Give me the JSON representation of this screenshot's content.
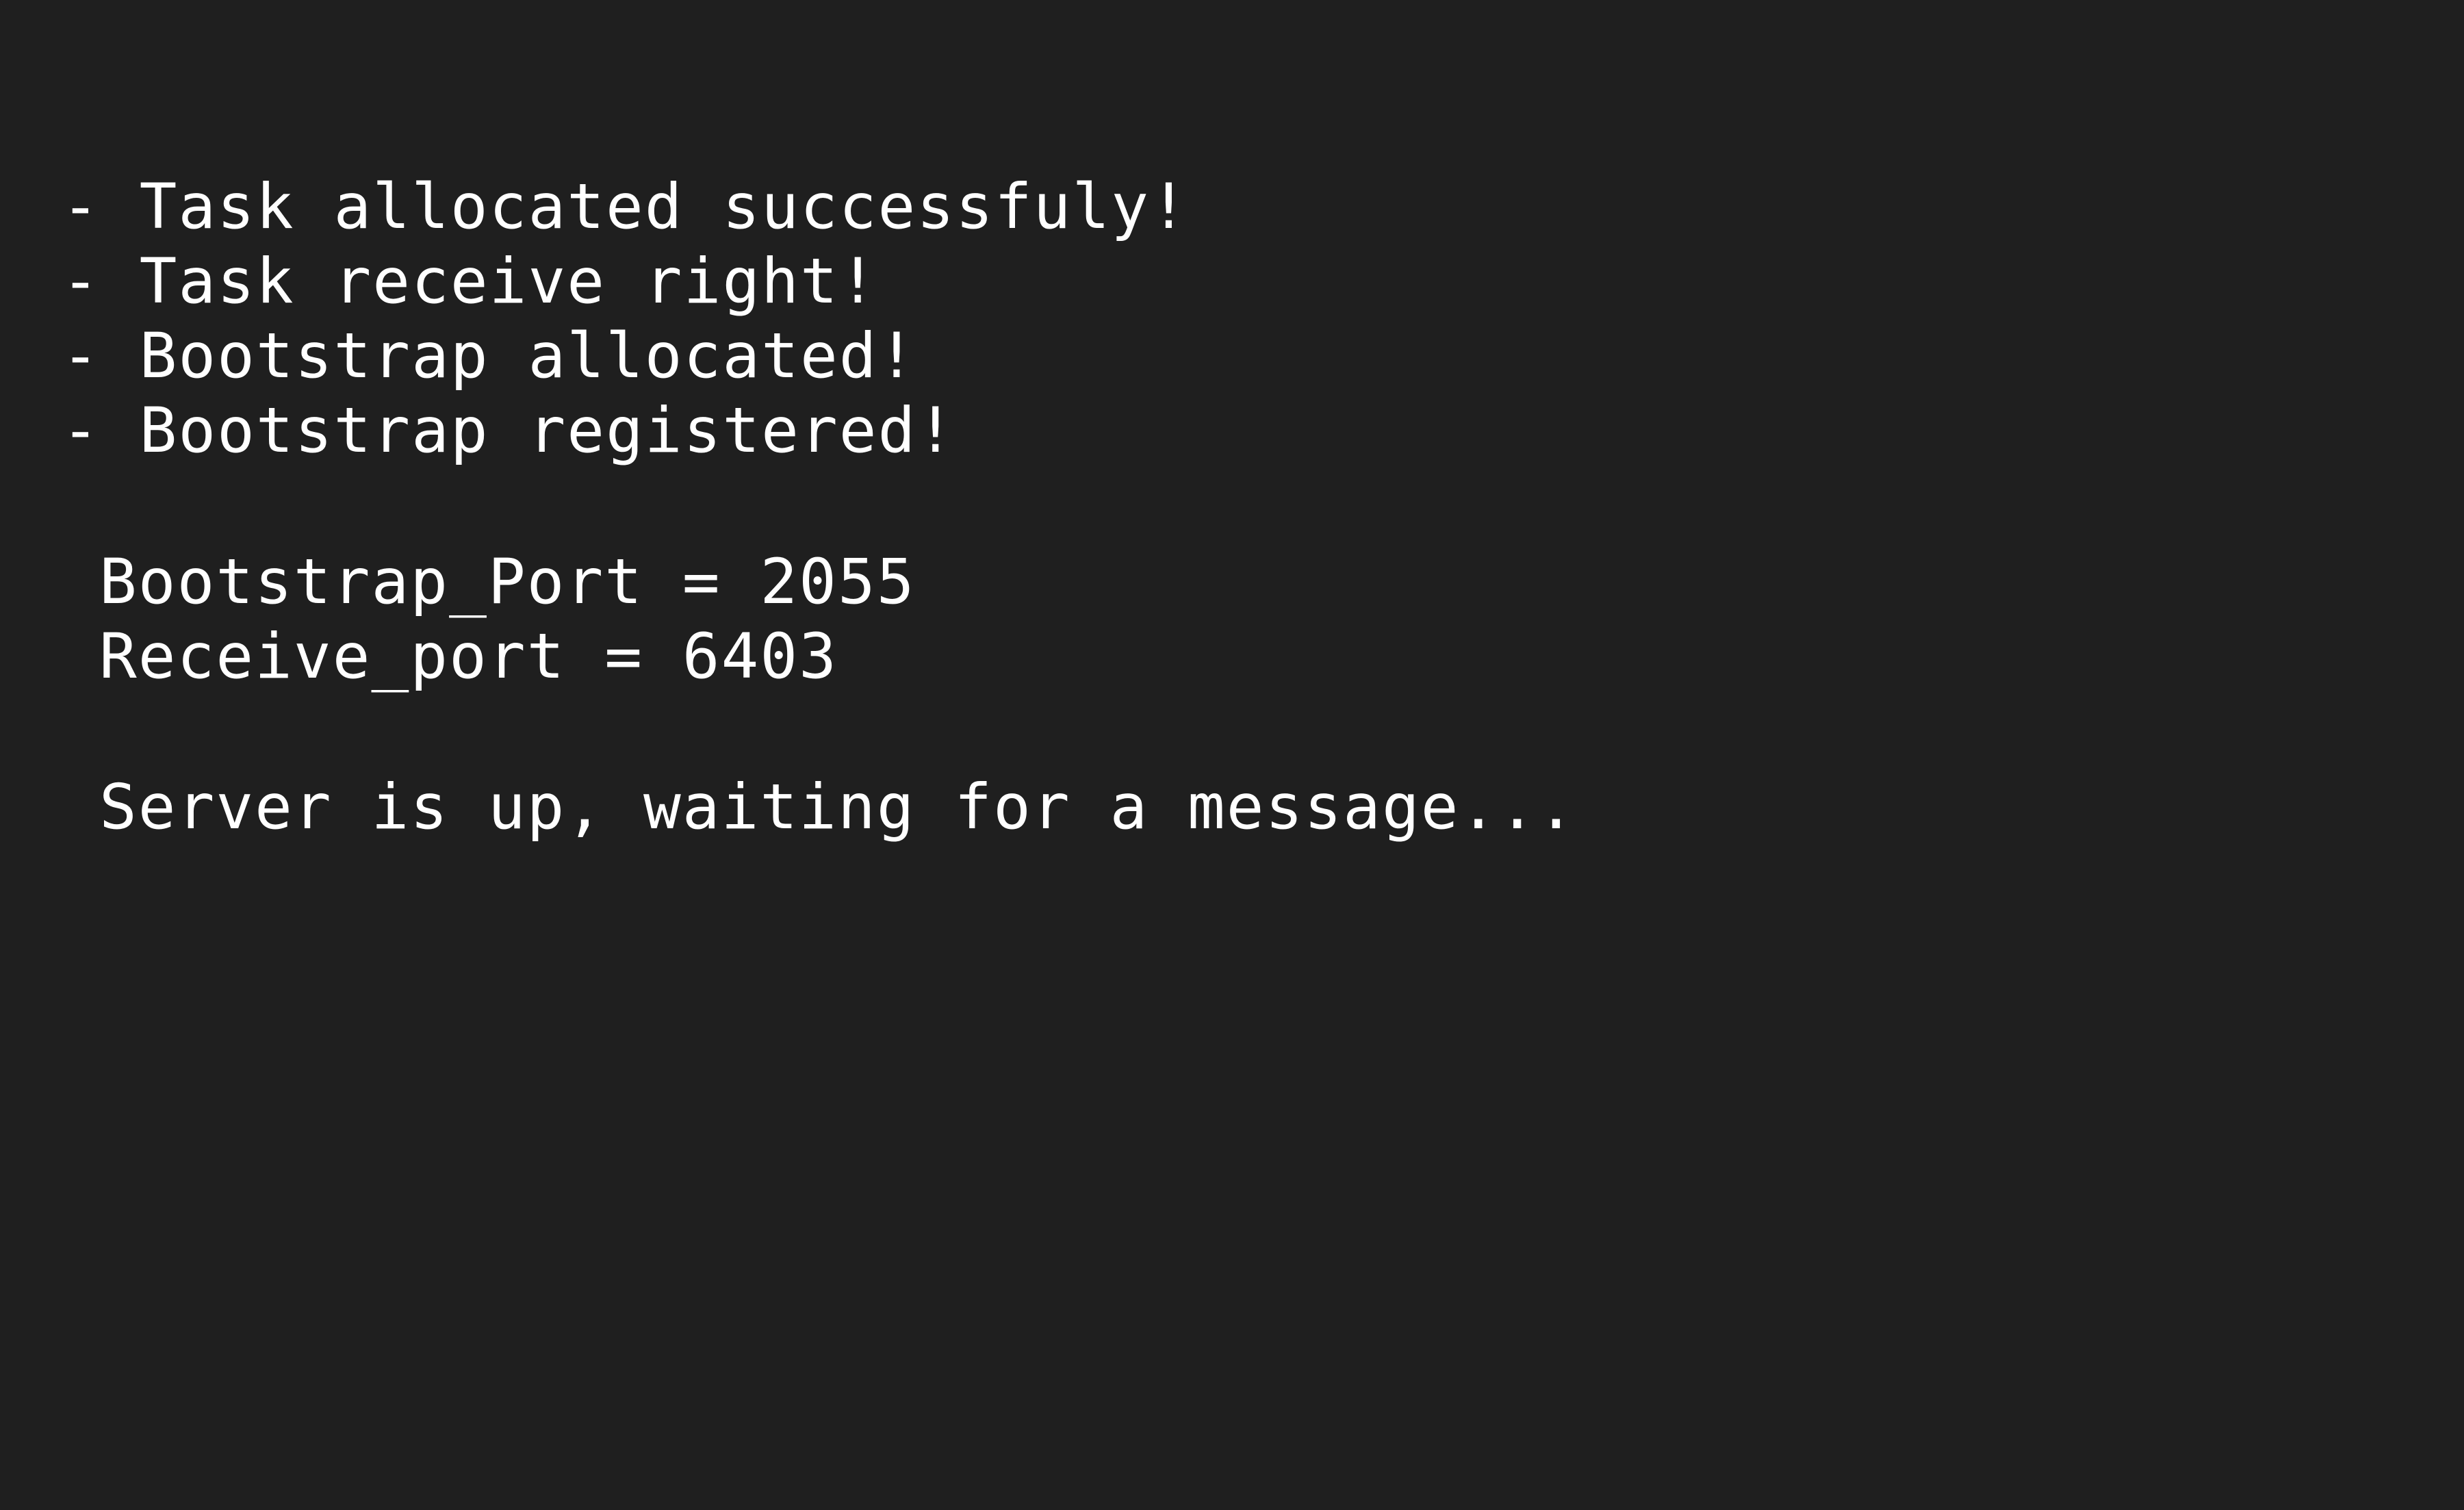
{
  "terminal": {
    "background": "#1f1f1f",
    "foreground": "#ffffff",
    "lines": [
      "- Task allocated successfuly!",
      "- Task receive right!",
      "- Bootstrap allocated!",
      "- Bootstrap registered!",
      "Bootstrap_Port = 2055",
      "Receive_port = 6403",
      "Server is up, waiting for a message..."
    ]
  }
}
